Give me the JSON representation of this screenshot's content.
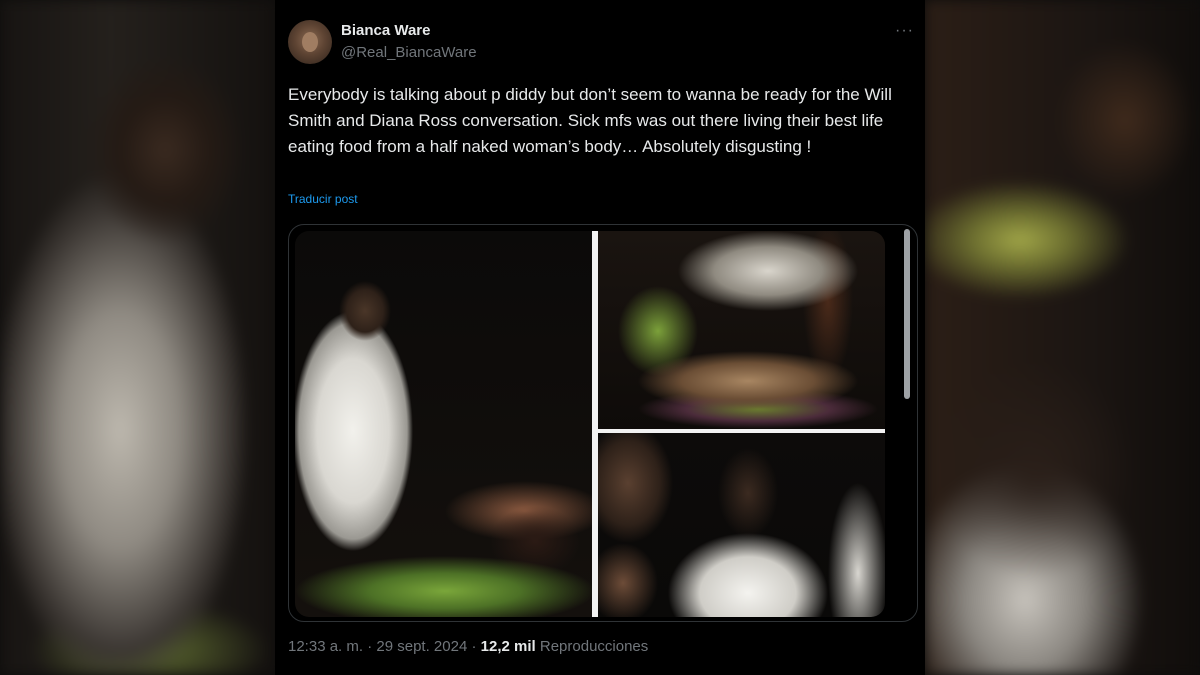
{
  "tweet": {
    "author_name": "Bianca Ware",
    "author_handle": "@Real_BiancaWare",
    "more_icon": "more-horizontal-icon",
    "text": "Everybody is talking about p diddy but don’t seem to wanna be ready for the Will Smith and Diana Ross conversation. Sick mfs was out there living their best life eating food from a half naked woman’s body… Absolutely disgusting !",
    "translate_label": "Traducir post",
    "time": "12:33 a. m.",
    "sep1": "·",
    "date": "29 sept. 2024",
    "sep2": "·",
    "views_count": "12,2 mil",
    "views_label": "Reproducciones"
  }
}
